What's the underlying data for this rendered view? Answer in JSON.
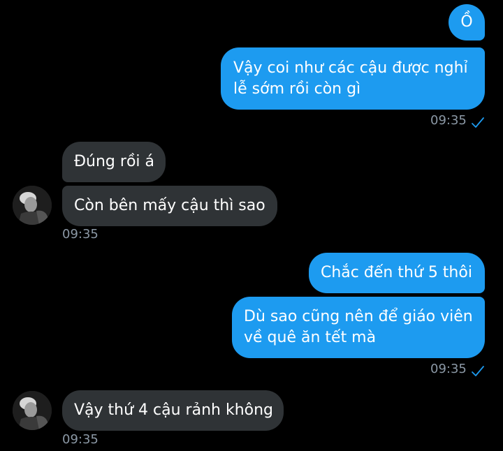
{
  "colors": {
    "background": "#000000",
    "outgoing_bubble": "#1d9bf0",
    "incoming_bubble": "#2f3336",
    "timestamp": "#8b98a5",
    "read_check": "#1d9bf0"
  },
  "messages": [
    {
      "direction": "outgoing",
      "text": "Ồ"
    },
    {
      "direction": "outgoing",
      "line1": "Vậy coi như các cậu được nghỉ",
      "line2": "lễ sớm rồi còn gì",
      "time": "09:35",
      "status_icon": "check-icon"
    },
    {
      "direction": "incoming",
      "text": "Đúng rồi á"
    },
    {
      "direction": "incoming",
      "text": "Còn bên mấy cậu thì sao",
      "time": "09:35",
      "avatar_icon": "avatar"
    },
    {
      "direction": "outgoing",
      "text": "Chắc đến thứ 5 thôi"
    },
    {
      "direction": "outgoing",
      "line1": "Dù sao cũng nên để giáo viên",
      "line2": "về quê ăn tết mà",
      "time": "09:35",
      "status_icon": "check-icon"
    },
    {
      "direction": "incoming",
      "text": "Vậy thứ 4 cậu rảnh không",
      "time": "09:35",
      "avatar_icon": "avatar"
    }
  ]
}
